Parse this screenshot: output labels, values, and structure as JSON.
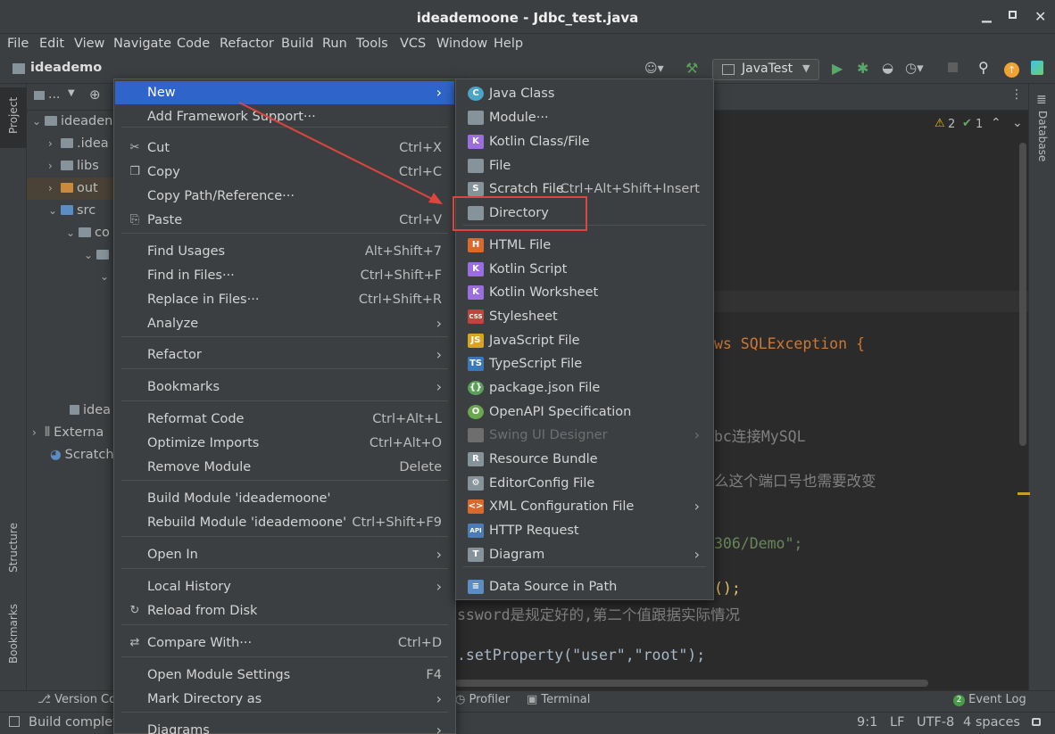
{
  "window": {
    "title": "ideademoone - Jdbc_test.java"
  },
  "menubar": [
    "File",
    "Edit",
    "View",
    "Navigate",
    "Code",
    "Refactor",
    "Build",
    "Run",
    "Tools",
    "VCS",
    "Window",
    "Help"
  ],
  "nav": {
    "project": "ideademo",
    "run_config": "JavaTest"
  },
  "side": {
    "project": "Project",
    "structure": "Structure",
    "bookmarks": "Bookmarks",
    "database": "Database"
  },
  "project_panel": {
    "toolbar": "...",
    "items": [
      "ideaden",
      ".idea",
      "libs",
      "out",
      "src",
      "co",
      "idea",
      "Externa",
      "Scratch"
    ]
  },
  "editor": {
    "warnings": "2",
    "oks": "1",
    "lines": [
      "ws SQLException {",
      "bc连接MySQL",
      "么这个端口号也需要改变",
      "306/Demo\";",
      "();",
      "ssword是规定好的,第二个值跟据实际情况",
      ".setProperty(\"user\",\"root\");"
    ]
  },
  "context_menu": {
    "items": [
      {
        "label": "New",
        "arrow": true,
        "selected": true
      },
      {
        "label": "Add Framework Support···"
      },
      {
        "label": "Cut",
        "shortcut": "Ctrl+X",
        "icon": "cut-icon"
      },
      {
        "label": "Copy",
        "shortcut": "Ctrl+C",
        "icon": "copy-icon"
      },
      {
        "label": "Copy Path/Reference···"
      },
      {
        "label": "Paste",
        "shortcut": "Ctrl+V",
        "icon": "paste-icon"
      },
      {
        "label": "Find Usages",
        "shortcut": "Alt+Shift+7"
      },
      {
        "label": "Find in Files···",
        "shortcut": "Ctrl+Shift+F"
      },
      {
        "label": "Replace in Files···",
        "shortcut": "Ctrl+Shift+R"
      },
      {
        "label": "Analyze",
        "arrow": true
      },
      {
        "label": "Refactor",
        "arrow": true
      },
      {
        "label": "Bookmarks",
        "arrow": true
      },
      {
        "label": "Reformat Code",
        "shortcut": "Ctrl+Alt+L"
      },
      {
        "label": "Optimize Imports",
        "shortcut": "Ctrl+Alt+O"
      },
      {
        "label": "Remove Module",
        "shortcut": "Delete"
      },
      {
        "label": "Build Module 'ideademoone'"
      },
      {
        "label": "Rebuild Module 'ideademoone'",
        "shortcut": "Ctrl+Shift+F9"
      },
      {
        "label": "Open In",
        "arrow": true
      },
      {
        "label": "Local History",
        "arrow": true
      },
      {
        "label": "Reload from Disk",
        "icon": "reload-icon"
      },
      {
        "label": "Compare With···",
        "shortcut": "Ctrl+D",
        "icon": "compare-icon"
      },
      {
        "label": "Open Module Settings",
        "shortcut": "F4"
      },
      {
        "label": "Mark Directory as",
        "arrow": true
      },
      {
        "label": "Diagrams",
        "arrow": true
      }
    ]
  },
  "submenu": {
    "items": [
      {
        "label": "Java Class"
      },
      {
        "label": "Module···"
      },
      {
        "label": "Kotlin Class/File"
      },
      {
        "label": "File"
      },
      {
        "label": "Scratch File",
        "shortcut": "Ctrl+Alt+Shift+Insert"
      },
      {
        "label": "Directory",
        "highlighted": true
      },
      {
        "label": "HTML File"
      },
      {
        "label": "Kotlin Script"
      },
      {
        "label": "Kotlin Worksheet"
      },
      {
        "label": "Stylesheet"
      },
      {
        "label": "JavaScript File"
      },
      {
        "label": "TypeScript File"
      },
      {
        "label": "package.json File"
      },
      {
        "label": "OpenAPI Specification"
      },
      {
        "label": "Swing UI Designer",
        "disabled": true,
        "arrow": true
      },
      {
        "label": "Resource Bundle"
      },
      {
        "label": "EditorConfig File"
      },
      {
        "label": "XML Configuration File",
        "arrow": true
      },
      {
        "label": "HTTP Request"
      },
      {
        "label": "Diagram",
        "arrow": true
      },
      {
        "label": "Data Source in Path"
      }
    ]
  },
  "bottom_tabs": [
    "Version Con",
    "Profiler",
    "Terminal",
    "Event Log"
  ],
  "event_log_count": "2",
  "status": {
    "message": "Build complete",
    "position": "9:1",
    "line_sep": "LF",
    "encoding": "UTF-8",
    "indent": "4 spaces"
  },
  "colors": {
    "accent": "#2f65ca",
    "annotation": "#e0443e"
  }
}
